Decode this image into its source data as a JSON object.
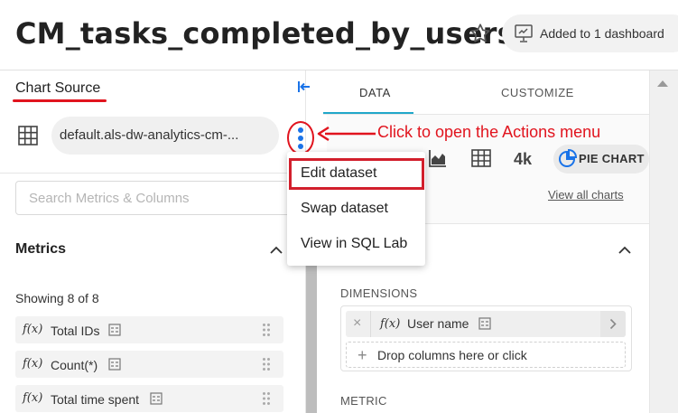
{
  "header": {
    "title": "CM_tasks_completed_by_users",
    "dashboard_badge": "Added to 1 dashboard"
  },
  "left_panel": {
    "chart_source_label": "Chart Source",
    "dataset_name": "default.als-dw-analytics-cm-...",
    "search_placeholder": "Search Metrics & Columns",
    "metrics_heading": "Metrics",
    "showing_count": "Showing 8 of 8",
    "metrics": [
      {
        "fx": "f(x)",
        "name": "Total IDs"
      },
      {
        "fx": "f(x)",
        "name": "Count(*)"
      },
      {
        "fx": "f(x)",
        "name": "Total time spent"
      }
    ]
  },
  "actions_menu": {
    "items": [
      "Edit dataset",
      "Swap dataset",
      "View in SQL Lab"
    ]
  },
  "annotation": {
    "text": "Click to open the Actions menu",
    "color": "#e1141e"
  },
  "right_panel": {
    "tabs": [
      "DATA",
      "CUSTOMIZE"
    ],
    "active_tab": "DATA",
    "big_number_icon": "4k",
    "selected_chart": "PIE CHART",
    "view_all_charts": "View all charts",
    "dimensions_label": "DIMENSIONS",
    "dimension": {
      "fx": "f(x)",
      "name": "User name"
    },
    "drop_zone_text": "Drop columns here or click",
    "metric_label": "METRIC"
  },
  "colors": {
    "accent_red": "#e1141e",
    "tab_underline": "#20a7c9",
    "collapse_icon": "#1a73e8"
  }
}
